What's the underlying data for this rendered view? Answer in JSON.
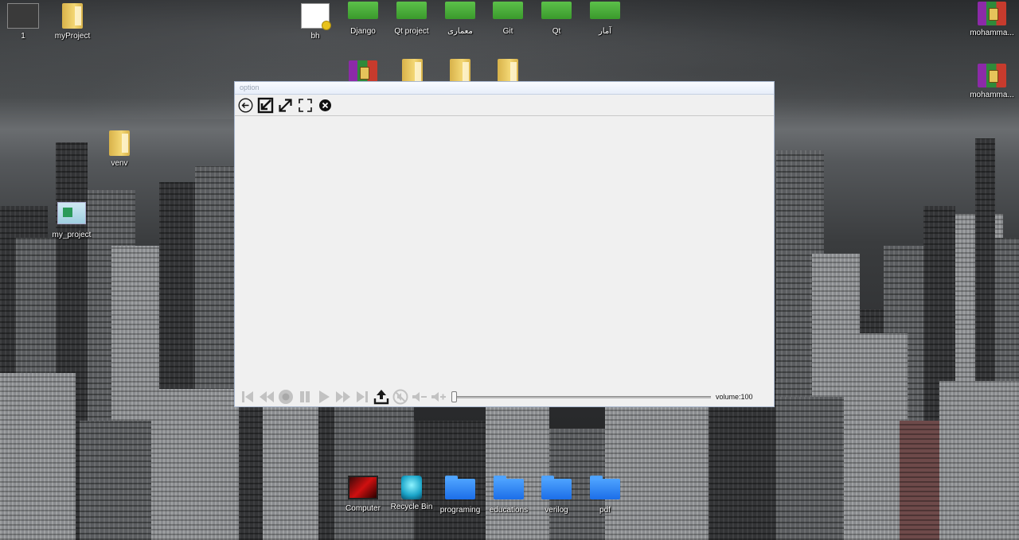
{
  "desktop": {
    "icons_top": [
      {
        "label": "1",
        "kind": "thumb"
      },
      {
        "label": "myProject",
        "kind": "folder"
      },
      {
        "label": "bh",
        "kind": "doc"
      },
      {
        "label": "Django",
        "kind": "green"
      },
      {
        "label": "Qt project",
        "kind": "green"
      },
      {
        "label": "معماری",
        "kind": "green"
      },
      {
        "label": "Git",
        "kind": "green"
      },
      {
        "label": "Qt",
        "kind": "green"
      },
      {
        "label": "آمار",
        "kind": "green"
      }
    ],
    "icons_right": [
      {
        "label": "mohamma...",
        "kind": "rar"
      },
      {
        "label": "mohamma...",
        "kind": "rar"
      }
    ],
    "icons_left": [
      {
        "label": "venv",
        "kind": "folder"
      },
      {
        "label": "my_project",
        "kind": "proj"
      }
    ],
    "icons_bottom": [
      {
        "label": "Computer",
        "kind": "computer"
      },
      {
        "label": "Recycle Bin",
        "kind": "bin"
      },
      {
        "label": "programing",
        "kind": "bluefolder"
      },
      {
        "label": "educations",
        "kind": "bluefolder"
      },
      {
        "label": "verilog",
        "kind": "bluefolder"
      },
      {
        "label": "pdf",
        "kind": "bluefolder"
      }
    ]
  },
  "window": {
    "title": "option",
    "toolbar": [
      {
        "name": "back-icon"
      },
      {
        "name": "shrink-icon"
      },
      {
        "name": "expand-icon"
      },
      {
        "name": "fullscreen-icon"
      },
      {
        "name": "close-icon"
      }
    ],
    "controls": [
      {
        "name": "skip-start-icon"
      },
      {
        "name": "rewind-icon"
      },
      {
        "name": "stop-icon"
      },
      {
        "name": "pause-icon"
      },
      {
        "name": "play-icon"
      },
      {
        "name": "fast-forward-icon"
      },
      {
        "name": "skip-end-icon"
      },
      {
        "name": "upload-icon"
      },
      {
        "name": "mute-icon"
      },
      {
        "name": "volume-down-icon"
      },
      {
        "name": "volume-up-icon"
      }
    ],
    "seek_position": 0,
    "volume_label": "volume:100"
  }
}
